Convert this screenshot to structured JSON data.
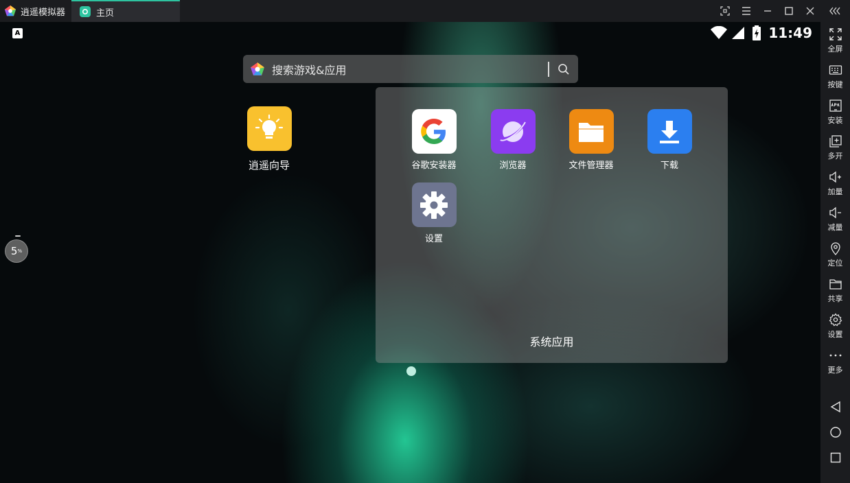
{
  "window": {
    "app_name": "逍遥模拟器",
    "tab_label": "主页"
  },
  "status_bar": {
    "time": "11:49",
    "left_indicator": "A"
  },
  "search": {
    "placeholder": "搜索游戏&应用"
  },
  "desktop": {
    "icons": [
      {
        "label": "逍遥向导",
        "icon": "lightbulb-icon",
        "color": "#f9c12e"
      }
    ]
  },
  "folder": {
    "title": "系统应用",
    "apps": [
      {
        "label": "谷歌安装器",
        "icon": "google-icon",
        "color": "#ffffff"
      },
      {
        "label": "浏览器",
        "icon": "planet-icon",
        "color": "#8b3cf0"
      },
      {
        "label": "文件管理器",
        "icon": "folder-icon",
        "color": "#ee8a12"
      },
      {
        "label": "下载",
        "icon": "download-icon",
        "color": "#2b7ff0"
      },
      {
        "label": "设置",
        "icon": "gear-icon",
        "color": "#6e7590"
      }
    ]
  },
  "floating_badge": {
    "value": "5",
    "unit": "%"
  },
  "sidebar": {
    "items": [
      {
        "label": "全屏",
        "icon": "fullscreen-icon"
      },
      {
        "label": "按键",
        "icon": "keyboard-icon"
      },
      {
        "label": "安装",
        "icon": "apk-icon"
      },
      {
        "label": "多开",
        "icon": "multi-instance-icon"
      },
      {
        "label": "加量",
        "icon": "volume-up-icon"
      },
      {
        "label": "减量",
        "icon": "volume-down-icon"
      },
      {
        "label": "定位",
        "icon": "location-icon"
      },
      {
        "label": "共享",
        "icon": "shared-folder-icon"
      },
      {
        "label": "设置",
        "icon": "settings-icon"
      },
      {
        "label": "更多",
        "icon": "more-icon"
      }
    ],
    "nav": [
      "back-icon",
      "home-icon",
      "recents-icon"
    ]
  },
  "colors": {
    "accent": "#2ec4a0",
    "titlebar": "#1b1c1f"
  }
}
